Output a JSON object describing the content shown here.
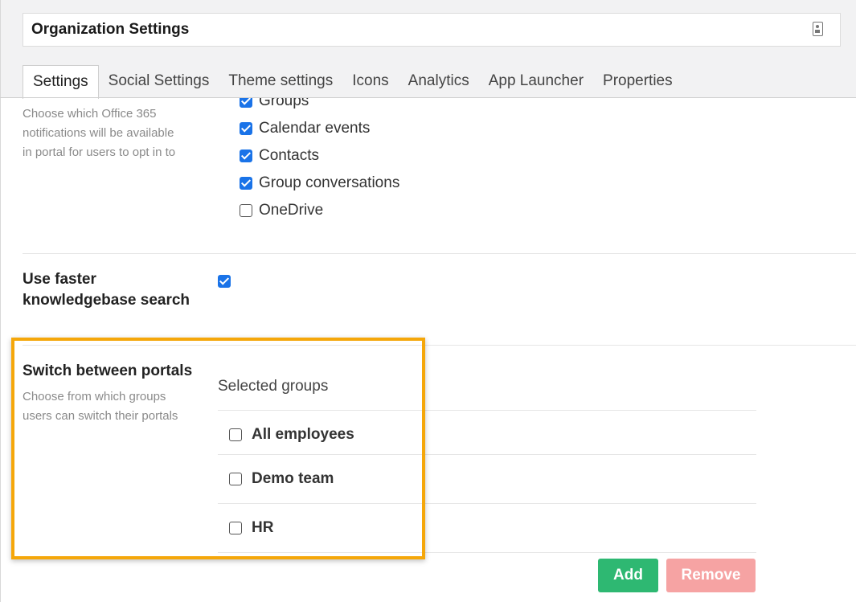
{
  "window": {
    "title": "Organization Settings",
    "title_icon": "contact-card-icon"
  },
  "tabs": [
    {
      "label": "Settings",
      "active": true
    },
    {
      "label": "Social Settings",
      "active": false
    },
    {
      "label": "Theme settings",
      "active": false
    },
    {
      "label": "Icons",
      "active": false
    },
    {
      "label": "Analytics",
      "active": false
    },
    {
      "label": "App Launcher",
      "active": false
    },
    {
      "label": "Properties",
      "active": false
    }
  ],
  "notifications": {
    "description": "Choose which Office 365 notifications will be available in portal for users to opt in to",
    "description_lines": [
      "Choose which Office 365",
      "notifications will be available",
      "in portal for users to opt in to"
    ],
    "options": [
      {
        "label": "Groups",
        "checked": true
      },
      {
        "label": "Calendar events",
        "checked": true
      },
      {
        "label": "Contacts",
        "checked": true
      },
      {
        "label": "Group conversations",
        "checked": true
      },
      {
        "label": "OneDrive",
        "checked": false
      }
    ]
  },
  "faster_search": {
    "label_lines": [
      "Use faster",
      "knowledgebase search"
    ],
    "checked": true
  },
  "switch_portals": {
    "title": "Switch between portals",
    "description_lines": [
      "Choose from which groups",
      "users can switch their portals"
    ],
    "selected_label": "Selected groups",
    "groups": [
      {
        "label": "All employees",
        "checked": false
      },
      {
        "label": "Demo team",
        "checked": false
      },
      {
        "label": "HR",
        "checked": false
      }
    ],
    "add_label": "Add",
    "remove_label": "Remove"
  },
  "colors": {
    "checkbox_checked": "#1a73e8",
    "highlight": "#f5a70a",
    "add_button": "#2eb872",
    "remove_button": "#f6a3a3"
  }
}
